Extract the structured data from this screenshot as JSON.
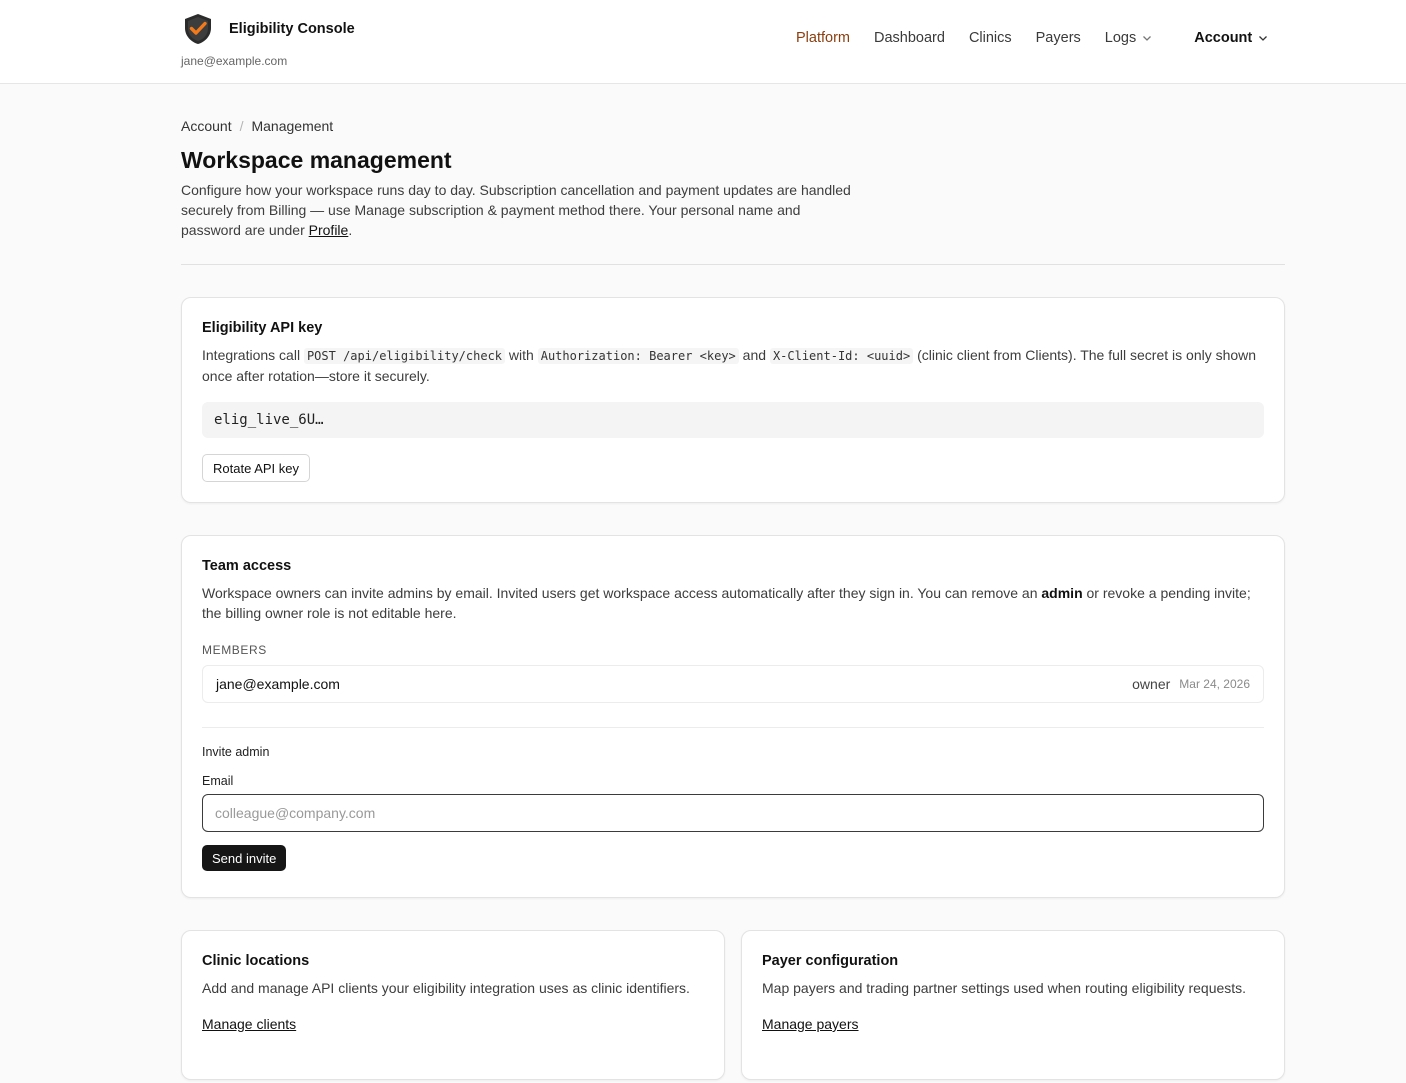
{
  "header": {
    "app_name": "Eligibility Console",
    "user_email": "jane@example.com",
    "nav": {
      "platform": "Platform",
      "dashboard": "Dashboard",
      "clinics": "Clinics",
      "payers": "Payers",
      "logs": "Logs",
      "account": "Account"
    },
    "accent_color": "#8a3e0e"
  },
  "breadcrumb": {
    "parent": "Account",
    "separator": "/",
    "current": "Management"
  },
  "page": {
    "title": "Workspace management",
    "intro_text": "Configure how your workspace runs day to day. Subscription cancellation and payment updates are handled securely from Billing — use Manage subscription & payment method there. Your personal name and password are under ",
    "intro_link": "Profile",
    "intro_end": "."
  },
  "api_key_card": {
    "title": "Eligibility API key",
    "desc_1": "Integrations call ",
    "code_1": "POST /api/eligibility/check",
    "desc_2": " with ",
    "code_2": "Authorization: Bearer <key>",
    "desc_3": " and ",
    "code_3": "X-Client-Id: <uuid>",
    "desc_4": " (clinic client from Clients). The full secret is only shown once after rotation—store it securely.",
    "key_preview": "elig_live_6U…",
    "rotate_label": "Rotate API key"
  },
  "team_card": {
    "title": "Team access",
    "desc_1": "Workspace owners can invite admins by email. Invited users get workspace access automatically after they sign in. You can remove an ",
    "desc_bold": "admin",
    "desc_2": " or revoke a pending invite; the billing owner role is not editable here.",
    "members_label": "MEMBERS",
    "members": [
      {
        "email": "jane@example.com",
        "role": "owner",
        "date": "Mar 24, 2026"
      }
    ],
    "invite_title": "Invite admin",
    "email_label": "Email",
    "email_value": "",
    "email_placeholder": "colleague@company.com",
    "send_label": "Send invite"
  },
  "clinic_card": {
    "title": "Clinic locations",
    "desc": "Add and manage API clients your eligibility integration uses as clinic identifiers.",
    "link": "Manage clients"
  },
  "payer_card": {
    "title": "Payer configuration",
    "desc": "Map payers and trading partner settings used when routing eligibility requests.",
    "link": "Manage payers"
  }
}
